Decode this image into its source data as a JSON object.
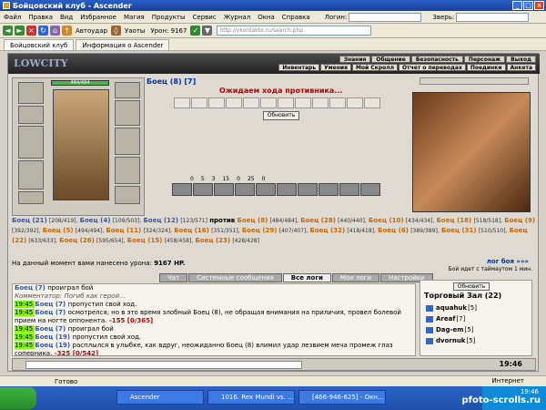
{
  "window": {
    "title": "Бойцовский клуб - Ascender"
  },
  "menubar": {
    "items": [
      "Файл",
      "Правка",
      "Вид",
      "Избранное",
      "Магия",
      "Продукты",
      "Сервис",
      "Журнал",
      "Окна",
      "Справка"
    ],
    "login_label": "Логин:",
    "beast_label": "Зверь:"
  },
  "toolbar": {
    "autohit_label": "Автоудар",
    "dodge_label": "Уаоты",
    "damage_label": "Урон: 9167",
    "address": "http://vkontakte.ru/search.php"
  },
  "tabs": [
    "Бойцовский клуб",
    "Информация о Ascender"
  ],
  "game": {
    "logo_text": "LOWCITY",
    "nav_top": [
      "Знания",
      "Общение",
      "Безопасность",
      "Персонаж",
      "Выход"
    ],
    "nav_bottom": [
      "Инвентарь",
      "Умения",
      "Мой Скролл",
      "Отчет о переводах",
      "Поединки",
      "Анкета"
    ],
    "hp_text": "484/484",
    "fighter_name": "Боец (8) [7]",
    "waiting_text": "Ожидаем хода противника...",
    "refresh_label": "Обновить",
    "counters": [
      "0",
      "5",
      "3",
      "15",
      "0",
      "25",
      "0"
    ],
    "teams_text": {
      "team1": [
        {
          "n": "Боец (21)",
          "s": "[208/419],"
        },
        {
          "n": "Боец (4)",
          "s": "[109/503],"
        },
        {
          "n": "Боец (12)",
          "s": "[123/571]"
        }
      ],
      "vs": "против",
      "team2": [
        {
          "n": "Боец (8)",
          "s": "[484/484],"
        },
        {
          "n": "Боец (28)",
          "s": "[440/440],"
        },
        {
          "n": "Боец (10)",
          "s": "[434/434],"
        },
        {
          "n": "Боец (18)",
          "s": "[518/518],"
        },
        {
          "n": "Боец (9)",
          "s": "[392/392],"
        },
        {
          "n": "Боец (5)",
          "s": "[494/494],"
        },
        {
          "n": "Боец (11)",
          "s": "[324/324],"
        },
        {
          "n": "Боец (16)",
          "s": "[351/351],"
        },
        {
          "n": "Боец (29)",
          "s": "[407/407],"
        },
        {
          "n": "Боец (32)",
          "s": "[418/418],"
        },
        {
          "n": "Боец (6)",
          "s": "[389/389],"
        },
        {
          "n": "Боец (31)",
          "s": "[510/510],"
        },
        {
          "n": "Боец (22)",
          "s": "[633/633],"
        },
        {
          "n": "Боец (26)",
          "s": "[595/654],"
        },
        {
          "n": "Боец (15)",
          "s": "[458/458],"
        },
        {
          "n": "Боец (23)",
          "s": "[428/428]"
        }
      ]
    },
    "damage_text": "На данный момент вами нанесено урона:",
    "damage_value": "9167 HP.",
    "fight_log_link": "лог боя »»»",
    "timeout_text": "Бой идет с таймаутом 1 мин.",
    "chat_tabs": [
      "Чат",
      "Системные сообщения",
      "Все логи",
      "Мои логи",
      "Настройки"
    ],
    "chat_lines": [
      {
        "time": "",
        "who": "Боец (7)",
        "text": "проиграл бой",
        "loss": ""
      },
      {
        "time": "",
        "who": "",
        "text": "Комментатор: Погиб как герой...",
        "loss": ""
      },
      {
        "time": "19:45",
        "who": "Боец (7)",
        "text": "пропустил свой ход.",
        "loss": ""
      },
      {
        "time": "19:45",
        "who": "Боец (7)",
        "text": "осмотрелся, но в это время злобный Боец (8), не обращая внимания на приличия, провел болевой прием на ногте оппонента.",
        "loss": "-155 [0/365]"
      },
      {
        "time": "19:45",
        "who": "Боец (7)",
        "text": "проиграл бой",
        "loss": ""
      },
      {
        "time": "19:45",
        "who": "Боец (19)",
        "text": "пропустил свой ход.",
        "loss": ""
      },
      {
        "time": "19:45",
        "who": "Боец (19)",
        "text": "расплылся в улыбке, как вдруг, неожиданно Боец (8) влимил удар лезвием меча промеж глаз соперника.",
        "loss": "-325 [0/542]"
      }
    ],
    "side": {
      "refresh_label": "Обновить",
      "room": "Торговый Зал (22)",
      "users": [
        {
          "name": "aquahuk",
          "lvl": "[5]"
        },
        {
          "name": "Areaf",
          "lvl": "[7]"
        },
        {
          "name": "Dag-em",
          "lvl": "[5]"
        },
        {
          "name": "dvornuk",
          "lvl": "[5]"
        }
      ]
    },
    "clock": "19:46"
  },
  "statusbar": {
    "ready": "Готово",
    "zone": "Интернет"
  },
  "taskbar": {
    "tasks": [
      "Ascender",
      "1016. Rex Mundi vs. ...",
      "[466-946-625] - Окн..."
    ],
    "time": "19:46",
    "watermark": "pfoto-scrolls.ru"
  }
}
